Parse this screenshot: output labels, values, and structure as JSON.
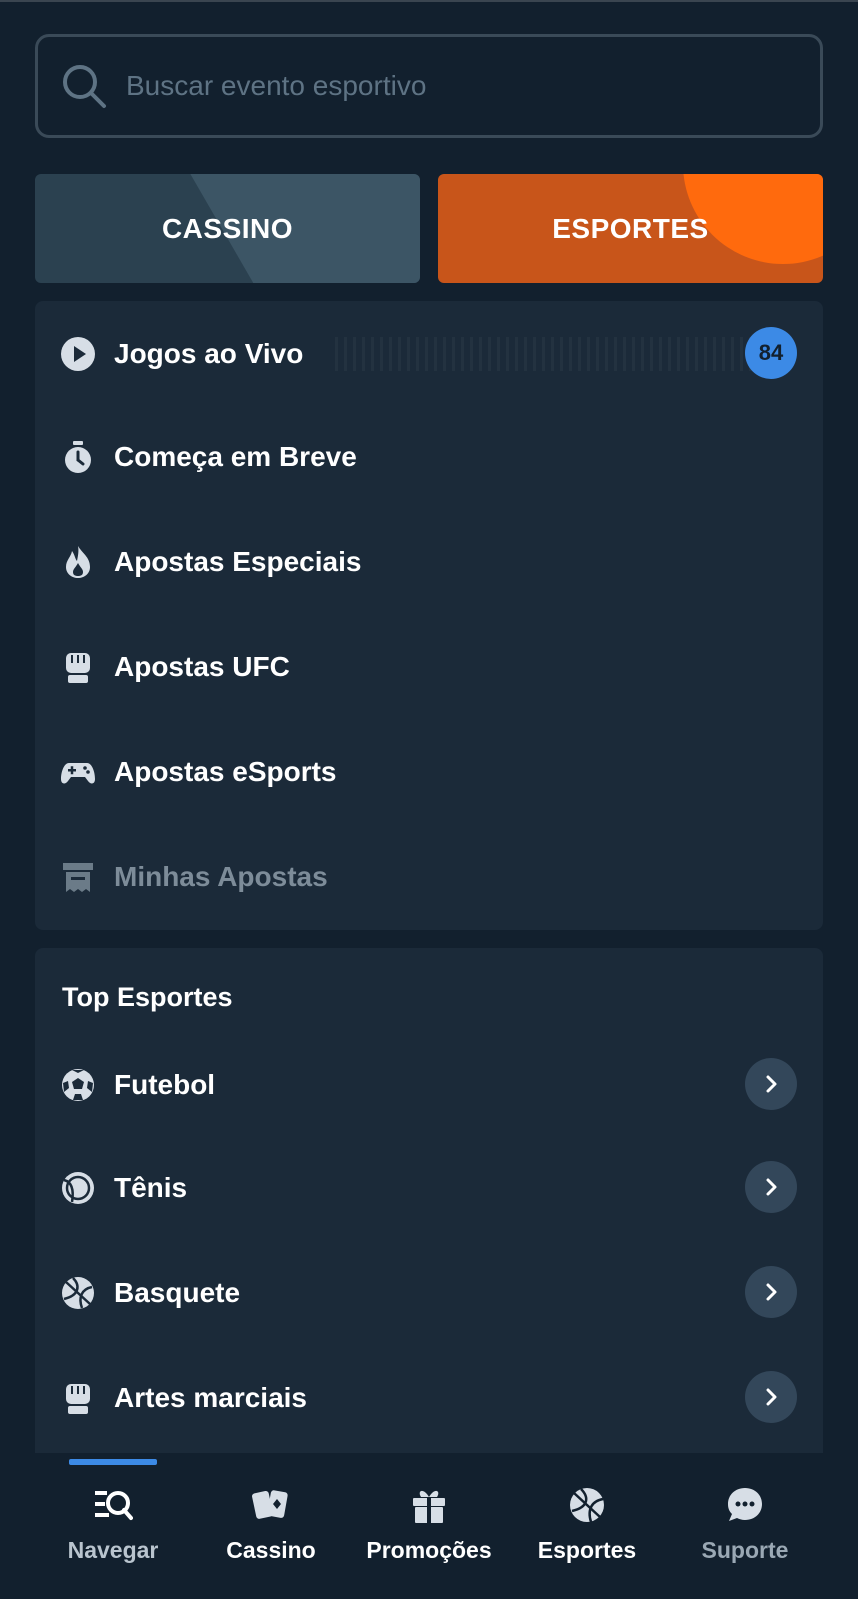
{
  "search": {
    "placeholder": "Buscar evento esportivo",
    "icon": "search-icon"
  },
  "tabs": [
    {
      "label": "CASSINO",
      "active": false
    },
    {
      "label": "ESPORTES",
      "active": true
    }
  ],
  "colors": {
    "background": "#12202e",
    "panel": "#1b2a39",
    "accent_orange": "#ff6a0d",
    "badge_blue": "#3c8ae6"
  },
  "menu": {
    "items": [
      {
        "label": "Jogos ao Vivo",
        "icon": "play-icon",
        "badge": "84"
      },
      {
        "label": "Começa em Breve",
        "icon": "stopwatch-icon"
      },
      {
        "label": "Apostas Especiais",
        "icon": "flame-icon"
      },
      {
        "label": "Apostas UFC",
        "icon": "fist-icon"
      },
      {
        "label": "Apostas eSports",
        "icon": "gamepad-icon"
      },
      {
        "label": "Minhas Apostas",
        "icon": "receipt-icon",
        "disabled": true
      }
    ]
  },
  "top_sports": {
    "title": "Top Esportes",
    "items": [
      {
        "label": "Futebol",
        "icon": "soccer-ball-icon"
      },
      {
        "label": "Tênis",
        "icon": "tennis-ball-icon"
      },
      {
        "label": "Basquete",
        "icon": "basketball-icon"
      },
      {
        "label": "Artes marciais",
        "icon": "fist-icon"
      }
    ]
  },
  "bottom_nav": {
    "items": [
      {
        "label": "Navegar",
        "icon": "browse-icon",
        "active": true
      },
      {
        "label": "Cassino",
        "icon": "cards-icon"
      },
      {
        "label": "Promoções",
        "icon": "gift-icon"
      },
      {
        "label": "Esportes",
        "icon": "basketball-icon"
      },
      {
        "label": "Suporte",
        "icon": "chat-bubble-icon"
      }
    ]
  }
}
